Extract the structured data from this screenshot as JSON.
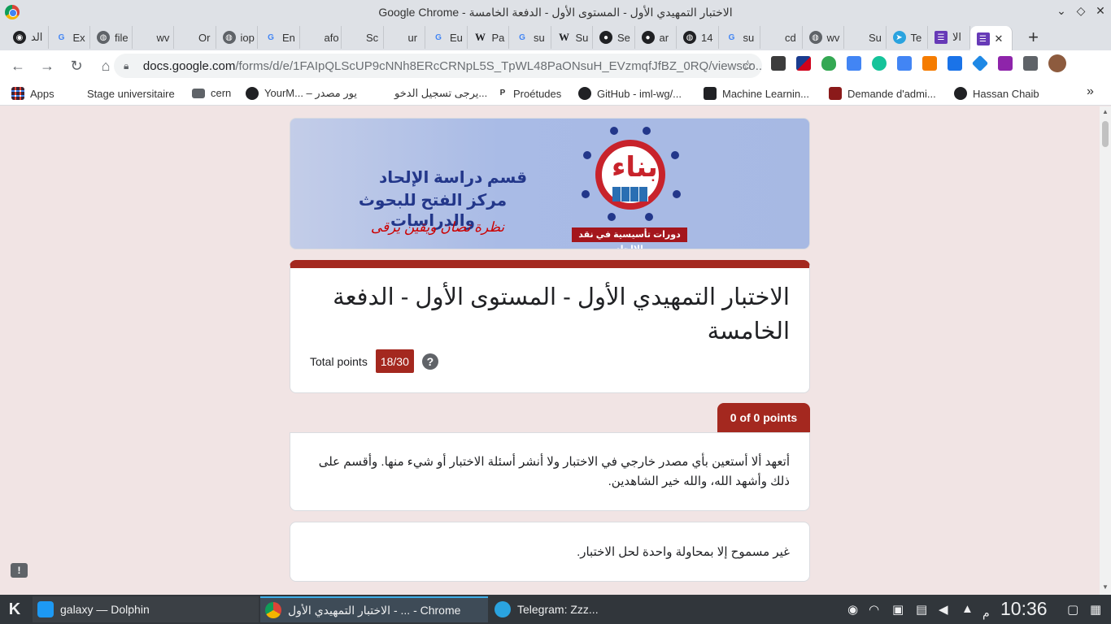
{
  "window": {
    "title": "Google Chrome - الاختبار التمهيدي الأول - المستوى الأول - الدفعة الخامسة"
  },
  "tabs": [
    {
      "label": "الد",
      "icon": "openai-icon"
    },
    {
      "label": "Ex",
      "icon": "google-icon"
    },
    {
      "label": "file",
      "icon": "globe-icon"
    },
    {
      "label": "wv",
      "icon": "blank-icon"
    },
    {
      "label": "Or",
      "icon": "blank-icon"
    },
    {
      "label": "iop",
      "icon": "globe-icon"
    },
    {
      "label": "En",
      "icon": "google-icon"
    },
    {
      "label": "afo",
      "icon": "blank-icon"
    },
    {
      "label": "Sc",
      "icon": "blank-icon"
    },
    {
      "label": "ur",
      "icon": "blank-icon"
    },
    {
      "label": "Eu",
      "icon": "google-icon"
    },
    {
      "label": "Pa",
      "icon": "wikipedia-icon"
    },
    {
      "label": "su",
      "icon": "google-icon"
    },
    {
      "label": "Su",
      "icon": "wikipedia-icon"
    },
    {
      "label": "Se",
      "icon": "github-icon"
    },
    {
      "label": "ar",
      "icon": "github-icon"
    },
    {
      "label": "14",
      "icon": "globe-icon"
    },
    {
      "label": "su",
      "icon": "google-icon"
    },
    {
      "label": "cd",
      "icon": "blank-icon"
    },
    {
      "label": "wv",
      "icon": "globe-icon"
    },
    {
      "label": "Su",
      "icon": "blank-icon"
    },
    {
      "label": "Te",
      "icon": "telegram-icon"
    },
    {
      "label": "الا",
      "icon": "forms-icon"
    }
  ],
  "active_tab_close": "✕",
  "new_tab": "+",
  "omnibox": {
    "host": "docs.google.com",
    "path": "/forms/d/e/1FAIpQLScUP9cNNh8ERcCRNpL5S_TpWL48PaONsuH_EVzmqfJfBZ_0RQ/viewsco..."
  },
  "bookmarks": [
    {
      "label": "Apps",
      "icon": "apps-grid-icon"
    },
    {
      "label": "Stage universitaire",
      "icon": "blank-icon"
    },
    {
      "label": "cern",
      "icon": "folder-icon"
    },
    {
      "label": "YourM... – يور مصدر",
      "icon": "globe-icon"
    },
    {
      "label": "يرجى تسجيل الدخو...",
      "icon": "blank-icon"
    },
    {
      "label": "Proétudes",
      "icon": "p-icon"
    },
    {
      "label": "GitHub - iml-wg/...",
      "icon": "github-icon"
    },
    {
      "label": "Machine Learnin...",
      "icon": "ml-icon"
    },
    {
      "label": "Demande d'admi...",
      "icon": "shield-crest-icon"
    },
    {
      "label": "Hassan Chaib",
      "icon": "globe-icon"
    }
  ],
  "bookmarks_more": "»",
  "banner": {
    "line1": "قسم دراسة الإلحاد",
    "line2": "مركز الفتح للبحوث والدراسات",
    "line3": "نظرة تصان ويقين يرقى",
    "logo_text": "بناء",
    "caption": "دورات تأسيسية في نقد الإلحاد"
  },
  "form": {
    "title": "الاختبار التمهيدي الأول - المستوى الأول - الدفعة الخامسة",
    "total_label": "Total points",
    "score": "18/30",
    "help": "?"
  },
  "section": {
    "points": "0 of 0 points",
    "q1": "أتعهد ألا أستعين بأي مصدر خارجي في الاختبار ولا أنشر أسئلة الاختبار أو شيء منها. وأقسم على ذلك وأشهد الله، والله خير الشاهدين.",
    "q2": "غير مسموح إلا بمحاولة واحدة لحل الاختبار."
  },
  "feedback_icon": "!",
  "taskbar": {
    "tasks": [
      {
        "label": "galaxy — Dolphin",
        "icon": "dolphin-icon"
      },
      {
        "label": "الاختبار التمهيدي الأول - ... - Chrome",
        "icon": "chrome-icon"
      },
      {
        "label": "Telegram: Zzz...",
        "icon": "telegram-icon"
      }
    ],
    "clock": "10:36",
    "ampm": "م"
  },
  "colors": {
    "accent": "#a4281f",
    "page_bg": "#f1e4e4",
    "taskbar_bg": "#31363b"
  }
}
